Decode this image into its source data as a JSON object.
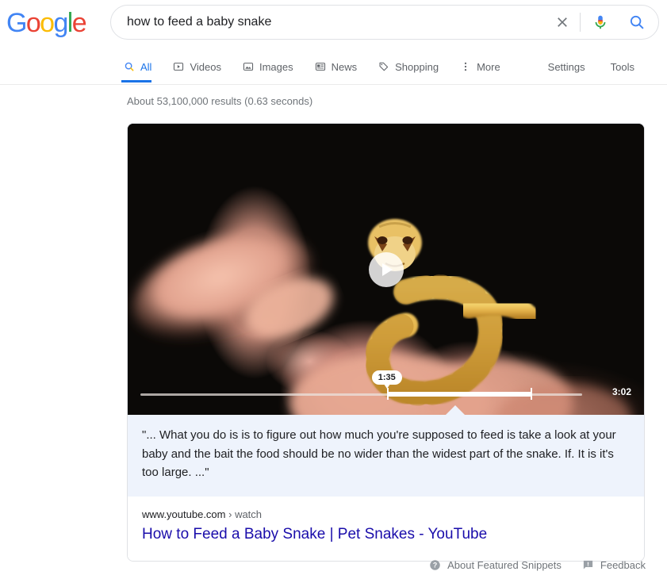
{
  "brand": {
    "logo_letters": [
      {
        "char": "G",
        "color": "#4285F4"
      },
      {
        "char": "o",
        "color": "#EA4335"
      },
      {
        "char": "o",
        "color": "#FBBC05"
      },
      {
        "char": "g",
        "color": "#4285F4"
      },
      {
        "char": "l",
        "color": "#34A853"
      },
      {
        "char": "e",
        "color": "#EA4335"
      }
    ],
    "logo_text": "Google"
  },
  "search": {
    "query": "how to feed a baby snake",
    "placeholder": "Search",
    "clear_icon": "close-icon",
    "voice_icon": "microphone-icon",
    "submit_icon": "search-icon"
  },
  "nav": {
    "tabs": [
      {
        "label": "All",
        "icon": "search-icon",
        "active": true
      },
      {
        "label": "Videos",
        "icon": "video-icon",
        "active": false
      },
      {
        "label": "Images",
        "icon": "image-icon",
        "active": false
      },
      {
        "label": "News",
        "icon": "news-icon",
        "active": false
      },
      {
        "label": "Shopping",
        "icon": "tag-icon",
        "active": false
      },
      {
        "label": "More",
        "icon": "overflow-menu-icon",
        "active": false
      }
    ],
    "right_items": [
      {
        "label": "Settings"
      },
      {
        "label": "Tools"
      }
    ],
    "active_color": "#1a73e8"
  },
  "results": {
    "stats": "About 53,100,000 results (0.63 seconds)"
  },
  "featured_snippet": {
    "video": {
      "play_icon": "play-button-icon",
      "current_time": "1:35",
      "duration": "3:02",
      "progress_percent": 50,
      "segment_end_percent": 80,
      "alt": "baby snake held on a fingertip against a black background"
    },
    "quote": "\"... What you do is is to figure out how much you're supposed to feed is take a look at your baby and the bait the food should be no wider than the widest part of the snake. If. It is it's too large. ...\"",
    "source_domain": "www.youtube.com",
    "source_path": "› watch",
    "title": "How to Feed a Baby Snake | Pet Snakes - YouTube",
    "title_color": "#1a0dab",
    "snippet_bg": "#eef3fc"
  },
  "footer": {
    "about_label": "About Featured Snippets",
    "about_icon": "help-circle-icon",
    "feedback_label": "Feedback",
    "feedback_icon": "feedback-flag-icon"
  }
}
